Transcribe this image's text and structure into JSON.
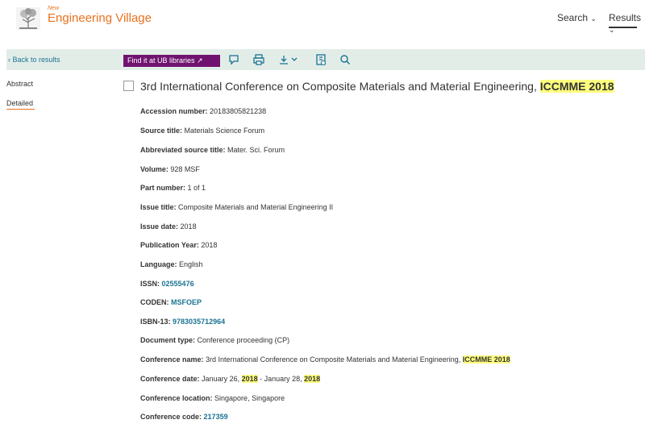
{
  "brand": {
    "new_label": "New",
    "name": "Engineering Village",
    "color": "#e9711c"
  },
  "nav": {
    "search": "Search",
    "results": "Results"
  },
  "toolbar": {
    "back": "Back to results",
    "find_ub": "Find it at UB libraries ↗",
    "icons": [
      "comment-icon",
      "print-icon",
      "download-icon",
      "bookmark-icon",
      "search-icon"
    ]
  },
  "sidebar": {
    "abstract": "Abstract",
    "detailed": "Detailed"
  },
  "document": {
    "title_main": "3rd International Conference on Composite Materials and Material Engineering, ",
    "title_highlight": "ICCMME 2018"
  },
  "fields": {
    "accession_label": "Accession number:",
    "accession_value": "20183805821238",
    "source_label": "Source title:",
    "source_value": "Materials Science Forum",
    "abbrev_label": "Abbreviated source title:",
    "abbrev_value": "Mater. Sci. Forum",
    "volume_label": "Volume:",
    "volume_value": "928 MSF",
    "part_label": "Part number:",
    "part_value": "1 of 1",
    "issue_title_label": "Issue title:",
    "issue_title_value": "Composite Materials and Material Engineering II",
    "issue_date_label": "Issue date:",
    "issue_date_value": "2018",
    "pub_year_label": "Publication Year:",
    "pub_year_value": "2018",
    "language_label": "Language:",
    "language_value": "English",
    "issn_label": "ISSN:",
    "issn_value": "02555476",
    "coden_label": "CODEN:",
    "coden_value": "MSFOEP",
    "isbn_label": "ISBN-13:",
    "isbn_value": "9783035712964",
    "doctype_label": "Document type:",
    "doctype_value": "Conference proceeding (CP)",
    "confname_label": "Conference name:",
    "confname_value": "3rd International Conference on Composite Materials and Material Engineering, ",
    "confname_hl": "ICCMME 2018",
    "confdate_label": "Conference date:",
    "confdate_part1": "January 26, ",
    "confdate_y1": "2018",
    "confdate_part2": " - January 28, ",
    "confdate_y2": "2018",
    "confloc_label": "Conference location:",
    "confloc_value": "Singapore, Singapore",
    "confcode_label": "Conference code:",
    "confcode_value": "217359"
  },
  "colors": {
    "accent": "#e9711c",
    "toolbar_bg": "#e3ede8",
    "button_purple": "#70136f",
    "link": "#1a7393",
    "highlight": "#fffe7e"
  }
}
